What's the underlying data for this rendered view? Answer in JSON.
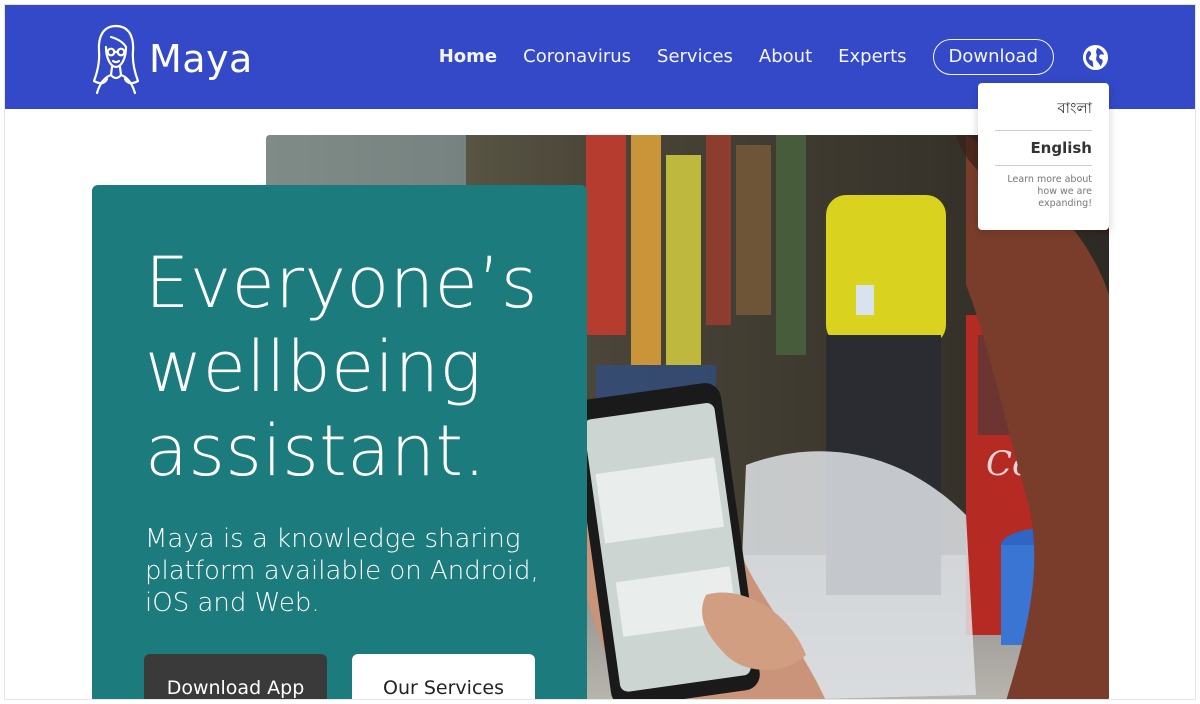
{
  "brand": {
    "name": "Maya",
    "logo_icon": "maya-woman-icon"
  },
  "nav": {
    "items": [
      {
        "label": "Home",
        "active": true
      },
      {
        "label": "Coronavirus",
        "active": false
      },
      {
        "label": "Services",
        "active": false
      },
      {
        "label": "About",
        "active": false
      },
      {
        "label": "Experts",
        "active": false
      }
    ],
    "download_label": "Download",
    "language_icon": "globe-icon"
  },
  "language_menu": {
    "options": [
      "বাংলা",
      "English"
    ],
    "selected": "English",
    "note": "Learn more about how we are expanding!"
  },
  "hero": {
    "headline": "Everyone’s wellbeing assistant.",
    "subtext": "Maya is a knowledge sharing platform available on Android, iOS and Web.",
    "primary_button": "Download App",
    "secondary_button": "Our Services"
  },
  "colors": {
    "header_bg": "#3449c8",
    "card_bg": "#1b7b7d",
    "dark_button": "#3a3a3a"
  }
}
